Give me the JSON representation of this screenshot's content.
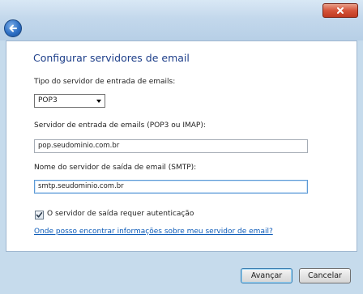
{
  "window": {
    "back_icon": "back-arrow-icon",
    "close_icon": "close-x-icon"
  },
  "heading": "Configurar servidores de email",
  "incoming_type": {
    "label": "Tipo do servidor de entrada de emails:",
    "selected": "POP3"
  },
  "incoming_server": {
    "label": "Servidor de entrada de emails (POP3 ou IMAP):",
    "value": "pop.seudominio.com.br"
  },
  "outgoing_server": {
    "label": "Nome do servidor de saída de email (SMTP):",
    "value": "smtp.seudominio.com.br"
  },
  "auth_checkbox": {
    "label": "O servidor de saída requer autenticação",
    "checked": true
  },
  "help_link": "Onde posso encontrar informações sobre meu servidor de email?",
  "buttons": {
    "next": "Avançar",
    "cancel": "Cancelar"
  },
  "colors": {
    "heading": "#1e3f8a",
    "link": "#0d5bb8",
    "frame": "#c6dbec"
  }
}
